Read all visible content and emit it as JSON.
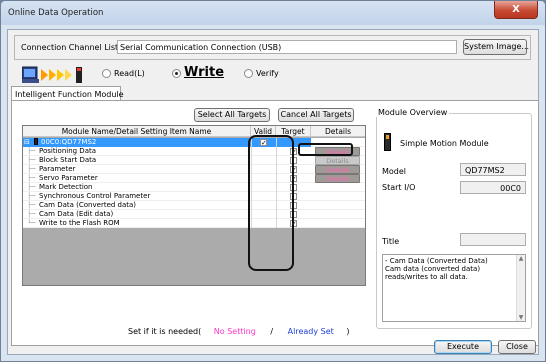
{
  "window": {
    "title": "Online Data Operation",
    "close_glyph": "X"
  },
  "connection": {
    "label": "Connection Channel List",
    "value": "Serial Communication Connection (USB)",
    "system_image_button": "System Image..."
  },
  "modes": [
    {
      "label": "Read(L)",
      "selected": false
    },
    {
      "label": "Write",
      "selected": true
    },
    {
      "label": "Verify",
      "selected": false
    }
  ],
  "tab": {
    "label": "Intelligent Function Module"
  },
  "toolbar": {
    "select_all": "Select All Targets",
    "cancel_all": "Cancel All Targets"
  },
  "grid": {
    "columns": [
      "Module Name/Detail Setting Item Name",
      "Valid",
      "Target",
      "Details"
    ],
    "rows": [
      {
        "name": "00C0:QD77MS2",
        "valid": true,
        "target": null,
        "details": null,
        "selected": true
      },
      {
        "name": "Positioning Data",
        "valid": null,
        "target": true,
        "details": "Details",
        "details_state": "set"
      },
      {
        "name": "Block Start Data",
        "valid": null,
        "target": false,
        "details": "Details",
        "details_state": "none"
      },
      {
        "name": "Parameter",
        "valid": null,
        "target": true,
        "details": "Details",
        "details_state": "set"
      },
      {
        "name": "Servo Parameter",
        "valid": null,
        "target": true,
        "details": "Details",
        "details_state": "set"
      },
      {
        "name": "Mark Detection",
        "valid": null,
        "target": false,
        "details": null
      },
      {
        "name": "Synchronous Control Parameter",
        "valid": null,
        "target": false,
        "details": null
      },
      {
        "name": "Cam Data (Converted data)",
        "valid": null,
        "target": false,
        "details": null
      },
      {
        "name": "Cam Data (Edit data)",
        "valid": null,
        "target": false,
        "details": null
      },
      {
        "name": "Write to the Flash ROM",
        "valid": null,
        "target": true,
        "details": null
      }
    ]
  },
  "legend": {
    "prefix": "Set if it is needed(",
    "no_setting": "No Setting",
    "slash": "/",
    "already_set": "Already Set",
    "suffix": ")"
  },
  "overview": {
    "title": "Module Overview",
    "module_name": "Simple Motion Module",
    "model_label": "Model",
    "model_value": "QD77MS2",
    "start_io_label": "Start I/O",
    "start_io_value": "00C0",
    "title_label": "Title",
    "title_value": "",
    "description": "- Cam Data (Converted Data)\nCam data (converted data) reads/writes to all data."
  },
  "footer": {
    "execute": "Execute",
    "close": "Close"
  },
  "colors": {
    "no_setting": "#ff33cc",
    "already_set": "#1f3fd6",
    "selection": "#3399ff"
  }
}
